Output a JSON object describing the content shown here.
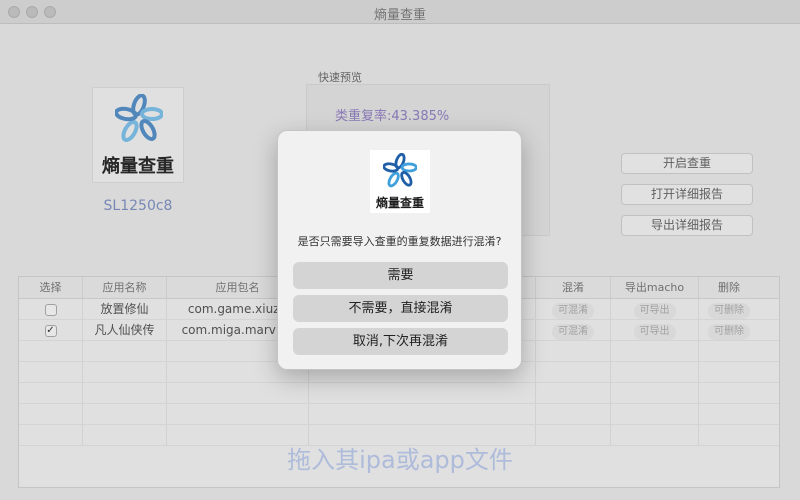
{
  "window": {
    "title": "熵量查重"
  },
  "app": {
    "logo_text": "熵量查重",
    "version": "SL1250c8"
  },
  "preview": {
    "label": "快速预览",
    "rate": "类重复率:43.385%"
  },
  "side_buttons": {
    "start": "开启查重",
    "open_report": "打开详细报告",
    "export_report": "导出详细报告"
  },
  "table": {
    "headers": {
      "select": "选择",
      "app_name": "应用名称",
      "package": "应用包名",
      "obfuscate": "混淆",
      "export_macho": "导出macho",
      "delete": "删除"
    },
    "rows": [
      {
        "checked": "",
        "name": "放置修仙",
        "package": "com.game.xiuzh",
        "obfuscate": "可混淆",
        "export": "可导出",
        "delete": "可删除"
      },
      {
        "checked": "✓",
        "name": "凡人仙侠传",
        "package": "com.miga.marvinc",
        "obfuscate": "可混淆",
        "export": "可导出",
        "delete": "可删除"
      }
    ],
    "drop_hint": "拖入其ipa或app文件"
  },
  "dialog": {
    "logo_text": "熵量查重",
    "message": "是否只需要导入查重的重复数据进行混淆?",
    "btn_yes": "需要",
    "btn_no": "不需要，直接混淆",
    "btn_cancel": "取消,下次再混淆"
  }
}
